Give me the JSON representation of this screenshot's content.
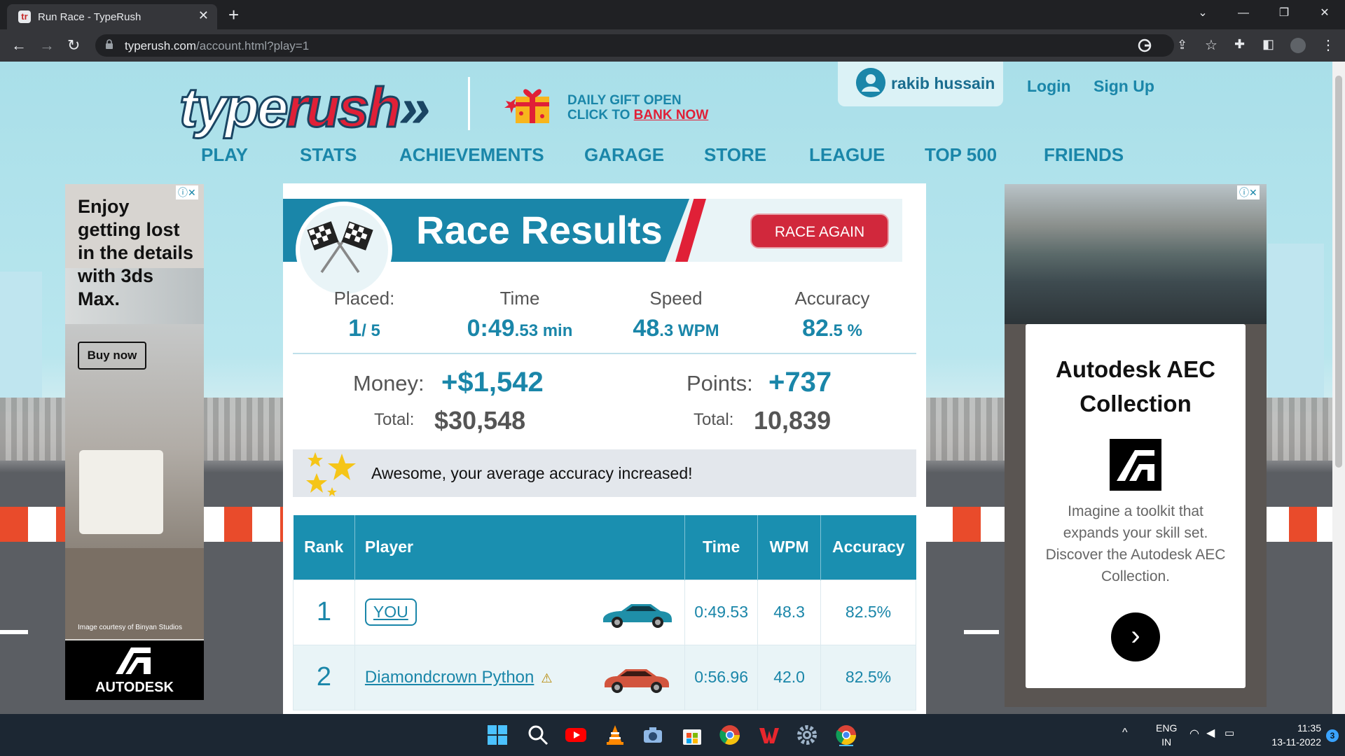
{
  "browser": {
    "tab_title": "Run Race - TypeRush",
    "new_tab_glyph": "+",
    "url_host": "typerush.com",
    "url_path": "/account.html?play=1"
  },
  "header": {
    "logo_part1": "type",
    "logo_part2": "rush",
    "logo_chevrons": "»",
    "gift_line1": "DAILY GIFT OPEN",
    "gift_line2_prefix": "CLICK TO ",
    "gift_line2_link": "BANK NOW",
    "username": "rakib hussain",
    "login": "Login",
    "signup": "Sign Up"
  },
  "nav": [
    "PLAY",
    "STATS",
    "ACHIEVEMENTS",
    "GARAGE",
    "STORE",
    "LEAGUE",
    "TOP 500",
    "FRIENDS"
  ],
  "ad_left": {
    "headline": "Enjoy getting lost in the details with 3ds Max.",
    "button": "Buy now",
    "credit": "Image courtesy of Binyan Studios",
    "brand": "AUTODESK"
  },
  "ad_right": {
    "headline": "Autodesk AEC Collection",
    "body": "Imagine a toolkit that expands your skill set. Discover the Autodesk AEC Collection.",
    "cta_glyph": "›"
  },
  "results": {
    "title": "Race Results",
    "race_again": "RACE AGAIN",
    "placed_label": "Placed:",
    "placed_value": "1",
    "placed_of": "/ 5",
    "time_label": "Time",
    "time_value": "0:49",
    "time_fraction": ".53 min",
    "speed_label": "Speed",
    "speed_value": "48",
    "speed_fraction": ".3 WPM",
    "accuracy_label": "Accuracy",
    "accuracy_value": "82",
    "accuracy_fraction": ".5 %",
    "money_label": "Money:",
    "money_value": "+$1,542",
    "money_total_label": "Total:",
    "money_total_value": "$30,548",
    "points_label": "Points:",
    "points_value": "+737",
    "points_total_label": "Total:",
    "points_total_value": "10,839",
    "notice": "Awesome, your average accuracy increased!",
    "table_headers": [
      "Rank",
      "Player",
      "Time",
      "WPM",
      "Accuracy"
    ],
    "rows": [
      {
        "rank": "1",
        "player": "YOU",
        "time": "0:49.53",
        "wpm": "48.3",
        "accuracy": "82.5%",
        "car_color": "#1f8fa8"
      },
      {
        "rank": "2",
        "player": "Diamondcrown Python",
        "time": "0:56.96",
        "wpm": "42.0",
        "accuracy": "82.5%",
        "car_color": "#d2553e"
      }
    ]
  },
  "taskbar": {
    "lang_line1": "ENG",
    "lang_line2": "IN",
    "time": "11:35",
    "date": "13-11-2022",
    "notifications": "3"
  },
  "colors": {
    "brand_blue": "#1a86a9",
    "brand_red": "#e02037",
    "table_header": "#1a8fb0"
  }
}
